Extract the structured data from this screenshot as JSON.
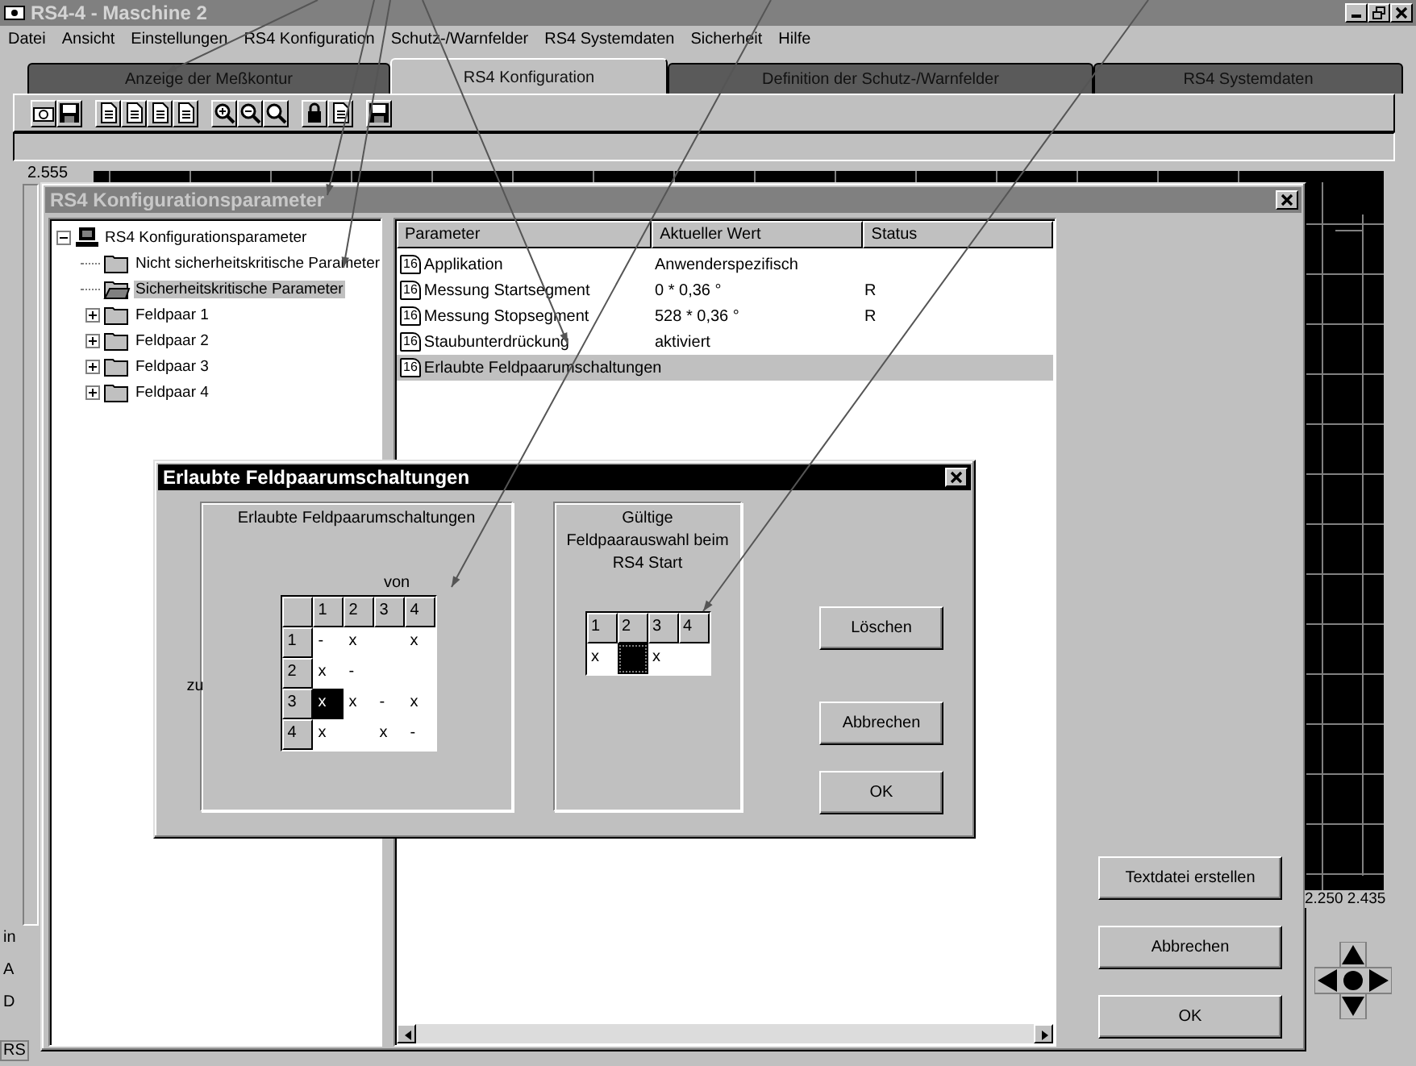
{
  "window": {
    "title": "RS4-4 - Maschine 2"
  },
  "menu": [
    {
      "label": "Datei"
    },
    {
      "label": "Ansicht"
    },
    {
      "label": "Einstellungen"
    },
    {
      "label": "RS4 Konfiguration"
    },
    {
      "label": "Schutz-/Warnfelder"
    },
    {
      "label": "RS4 Systemdaten"
    },
    {
      "label": "Sicherheit"
    },
    {
      "label": "Hilfe"
    }
  ],
  "tabs": [
    {
      "label": "Anzeige der Meßkontur",
      "selected": false
    },
    {
      "label": "RS4 Konfiguration",
      "selected": true
    },
    {
      "label": "Definition der Schutz-/Warnfelder",
      "selected": false
    },
    {
      "label": "RS4 Systemdaten",
      "selected": false
    }
  ],
  "plot": {
    "top_label": "2.555",
    "bottom_labels": "2.250 2.435"
  },
  "side_texts": [
    "in",
    "A",
    "D"
  ],
  "status_bar": "RS",
  "config_dialog": {
    "title": "RS4 Konfigurationsparameter",
    "tree": [
      {
        "label": "RS4 Konfigurationsparameter",
        "kind": "root",
        "expanded": true,
        "selected": false,
        "children": [
          {
            "label": "Nicht sicherheitskritische Parameter",
            "kind": "folder",
            "selected": false
          },
          {
            "label": "Sicherheitskritische Parameter",
            "kind": "folder",
            "selected": true
          },
          {
            "label": "Feldpaar 1",
            "kind": "folder",
            "expanded": false,
            "selected": false
          },
          {
            "label": "Feldpaar 2",
            "kind": "folder",
            "expanded": false,
            "selected": false
          },
          {
            "label": "Feldpaar 3",
            "kind": "folder",
            "expanded": false,
            "selected": false
          },
          {
            "label": "Feldpaar 4",
            "kind": "folder",
            "expanded": false,
            "selected": false
          }
        ]
      }
    ],
    "table": {
      "columns": [
        "Parameter",
        "Aktueller Wert",
        "Status"
      ],
      "rows": [
        {
          "badge": "16",
          "parameter": "Applikation",
          "value": "Anwenderspezifisch",
          "selected": false
        },
        {
          "badge": "16",
          "parameter": "Messung Startsegment",
          "value": "0 * 0,36 °",
          "status": "R",
          "selected": false
        },
        {
          "badge": "16",
          "parameter": "Messung Stopsegment",
          "value": "528 * 0,36 °",
          "status": "R",
          "selected": false
        },
        {
          "badge": "16",
          "parameter": "Staubunterdrückung",
          "value": "aktiviert",
          "selected": false
        },
        {
          "badge": "16",
          "parameter": "Erlaubte Feldpaarumschaltungen",
          "selected": true
        }
      ]
    },
    "buttons": [
      {
        "label": "Textdatei erstellen"
      },
      {
        "label": "Abbrechen"
      },
      {
        "label": "OK"
      }
    ]
  },
  "switch_dialog": {
    "title": "Erlaubte Feldpaarumschaltungen",
    "matrix": {
      "title": "Erlaubte Feldpaarumschaltungen",
      "column_caption": "von",
      "row_caption": "zu",
      "columns": [
        "1",
        "2",
        "3",
        "4"
      ],
      "rows": [
        {
          "label": "1",
          "cells": [
            {
              "text": "-",
              "selected": false
            },
            {
              "text": "x",
              "selected": false
            },
            {
              "selected": false
            },
            {
              "text": "x",
              "selected": false
            }
          ]
        },
        {
          "label": "2",
          "cells": [
            {
              "text": "x",
              "selected": false
            },
            {
              "text": "-",
              "selected": false
            },
            {
              "selected": false
            },
            {
              "selected": false
            }
          ]
        },
        {
          "label": "3",
          "cells": [
            {
              "text": "x",
              "selected": true
            },
            {
              "text": "x",
              "selected": false
            },
            {
              "text": "-",
              "selected": false
            },
            {
              "text": "x",
              "selected": false
            }
          ]
        },
        {
          "label": "4",
          "cells": [
            {
              "text": "x",
              "selected": false
            },
            {
              "selected": false
            },
            {
              "text": "x",
              "selected": false
            },
            {
              "text": "-",
              "selected": false
            }
          ]
        }
      ]
    },
    "start": {
      "title_lines": [
        "Gültige",
        "Feldpaarauswahl beim",
        "RS4 Start"
      ],
      "columns": [
        "1",
        "2",
        "3",
        "4"
      ],
      "cells": [
        {
          "text": "x",
          "selected": false
        },
        {
          "selected": true
        },
        {
          "text": "x",
          "selected": false
        },
        {
          "selected": false
        }
      ]
    },
    "buttons": [
      {
        "label": "Löschen"
      },
      {
        "label": "Abbrechen"
      },
      {
        "label": "OK"
      }
    ]
  }
}
